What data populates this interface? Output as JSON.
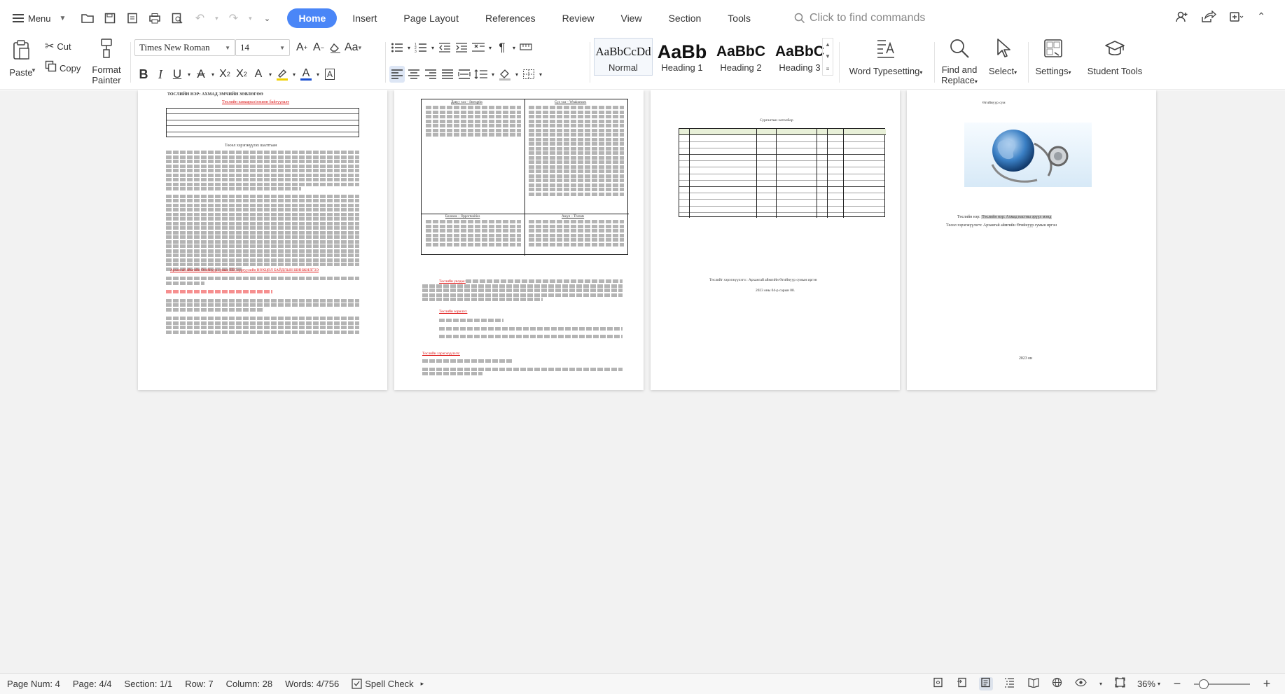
{
  "menu": {
    "label": "Menu"
  },
  "tabs": [
    "Home",
    "Insert",
    "Page Layout",
    "References",
    "Review",
    "View",
    "Section",
    "Tools"
  ],
  "search": {
    "placeholder": "Click to find commands"
  },
  "ribbon": {
    "paste": "Paste",
    "cut": "Cut",
    "copy": "Copy",
    "format_painter_line1": "Format",
    "format_painter_line2": "Painter",
    "font_name": "Times New Roman",
    "font_size": "14",
    "styles": [
      {
        "sample": "AaBbCcDd",
        "name": "Normal"
      },
      {
        "sample": "AaBb",
        "name": "Heading 1"
      },
      {
        "sample": "AaBbC",
        "name": "Heading 2"
      },
      {
        "sample": "AaBbC",
        "name": "Heading 3"
      }
    ],
    "word_typesetting": "Word Typesetting",
    "find_replace_line1": "Find and",
    "find_replace_line2": "Replace",
    "select": "Select",
    "settings": "Settings",
    "student_tools": "Student Tools"
  },
  "pages": {
    "p1": {
      "header": "ТОСЛИЙН НЭР:      АХМАД ЭМЧИЙН ЗӨВЛӨГӨӨ",
      "red_title": "Төслийн хамаарал/зохион байгуулалт",
      "section_title": "Төсөл хэрэгжүүлэх шалтгаан",
      "red_section": "Архангай аймгийн Өгийнуур сумын ЕБС сургуулийн НӨХЦӨЛ БАЙДЛЫН ШИНЖИЛГЭЭ"
    },
    "p2": {
      "swot_s": "Давуу тал – Strengths",
      "swot_w": "Сул тал – Weaknesses",
      "swot_o": "Боломж – Opportunities",
      "swot_t": "Аюул – Threats",
      "red1": "Төслийн уялдаа:",
      "red2": "Төслийн зорилго:",
      "red3": "Төслийн хэрэгжүүлэгч:"
    },
    "p3": {
      "title": "Сургалтын хөтөлбөр",
      "footer1": "Төслийг хэрэгжүүлэгч : Архангай аймгийн Өгийнуур сумын иргэн",
      "footer2": "2023 оны 04-р сарын 08."
    },
    "p4": {
      "top": "Өгийнуур сум",
      "name_line": "Төслийн нэр: Ахмад настны эрүүл мэнд",
      "author_line": "Төсөл хэрэгжүүлэгч: Архангай аймгийн Өгийнуур сумын иргэн",
      "year": "2023 он"
    }
  },
  "status": {
    "page_num": "Page Num: 4",
    "page": "Page: 4/4",
    "section": "Section: 1/1",
    "row": "Row: 7",
    "column": "Column: 28",
    "words": "Words: 4/756",
    "spell": "Spell Check",
    "zoom": "36%",
    "zoom_level": 0.36
  }
}
